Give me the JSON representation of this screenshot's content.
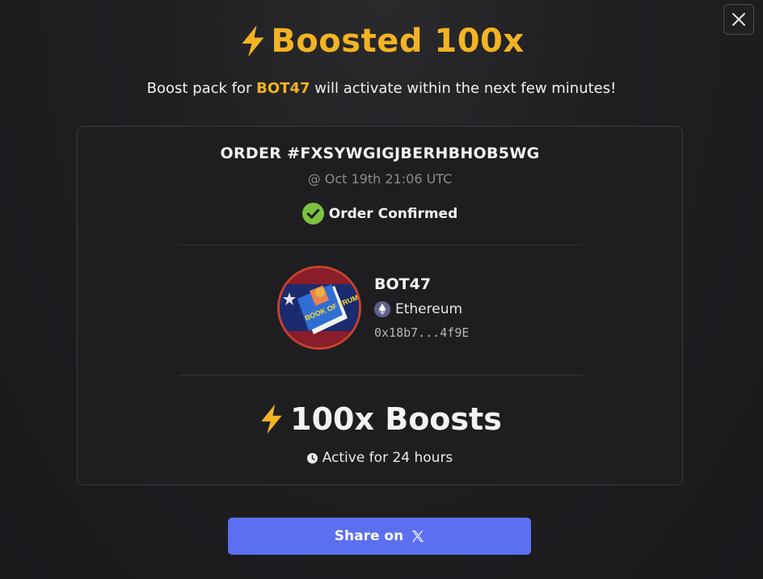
{
  "header": {
    "title": "Boosted 100x",
    "subtitle_prefix": "Boost pack for",
    "subtitle_token": "BOT47",
    "subtitle_suffix": "will activate within the next few minutes!"
  },
  "order": {
    "id": "ORDER #FXSYWGIGJBERHBHOB5WG",
    "time": "@ Oct 19th 21:06 UTC",
    "status": "Order Confirmed"
  },
  "token": {
    "name": "BOT47",
    "chain": "Ethereum",
    "address": "0x18b7...4f9E",
    "avatar_icon": "book-of-trump-avatar",
    "avatar_text": "BOOK OF TRUMP"
  },
  "boost": {
    "amount": "100x Boosts",
    "duration": "Active for 24 hours"
  },
  "share": {
    "label": "Share on"
  },
  "icons": {
    "close": "close-icon",
    "bolt": "lightning-bolt-icon",
    "check": "check-circle-icon",
    "ethereum": "ethereum-icon",
    "clock": "clock-icon",
    "x": "x-logo-icon"
  },
  "colors": {
    "accent": "#f3b323",
    "success": "#7dc142",
    "button": "#5c6ff0"
  }
}
